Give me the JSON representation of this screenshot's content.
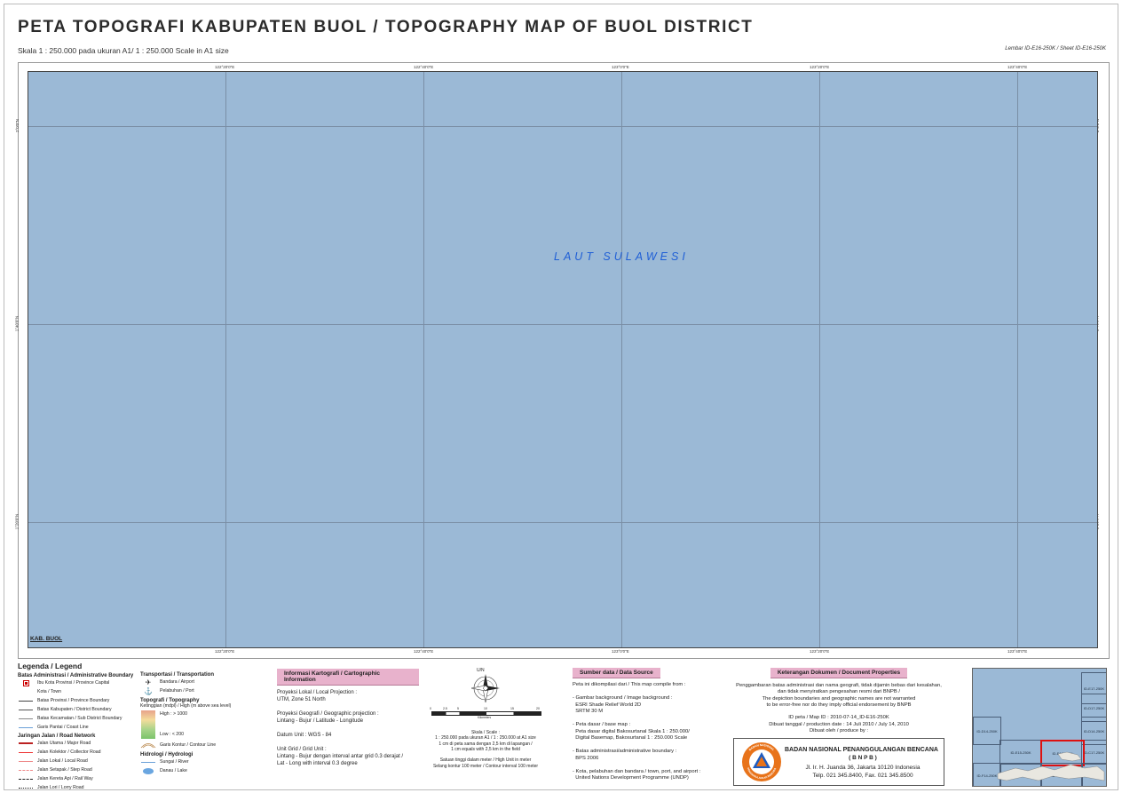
{
  "header": {
    "title": "PETA TOPOGRAFI KABUPATEN BUOL / TOPOGRAPHY MAP OF BUOL DISTRICT",
    "subtitle": "Skala 1 : 250.000 pada ukuran A1/ 1 : 250.000 Scale in A1 size",
    "sheet": "Lembar ID-E16-250K / Sheet ID-E16-250K"
  },
  "map": {
    "sea_label": "LAUT SULAWESI",
    "district_label": "KAB. BUOL",
    "sea_color": "#9bb9d6",
    "lon_ticks": [
      "122°20'0\"E",
      "122°40'0\"E",
      "123°0'0\"E",
      "123°20'0\"E",
      "123°40'0\"E"
    ],
    "lat_ticks": [
      "2°0'0\"N",
      "1°40'0\"N",
      "1°20'0\"N"
    ]
  },
  "legend": {
    "title": "Legenda / Legend",
    "admin": {
      "title": "Batas Administrasi / Administrative Boundary",
      "items": [
        "Ibu Kota Provinsi / Province Capital",
        "Kota / Town",
        "Batas Provinsi / Province Boundary",
        "Batas Kabupaten / District Boundary",
        "Batas Kecamatan / Sub District Boundary",
        "Garis Pantai / Coast Line"
      ]
    },
    "road": {
      "title": "Jaringan Jalan / Road Network",
      "items": [
        "Jalan Utama / Major Road",
        "Jalan Kolektor / Collector Road",
        "Jalan Lokal / Local Road",
        "Jalan Setapak / Step Road",
        "Jalan Kereta Api / Rail Way",
        "Jalan Lori / Lorry Road"
      ]
    },
    "transport": {
      "title": "Transportasi / Transportation",
      "items": [
        "Bandara / Airport",
        "Pelabuhan / Port"
      ]
    },
    "topo": {
      "title": "Topografi / Topography",
      "subtitle": "Ketinggian (mdpl) / High (m above sea level)",
      "high": "High : > 1000",
      "low": "Low : < 200",
      "contour": "Garis Kontur / Contour Line"
    },
    "hydro": {
      "title": "Hidrologi / Hydrologi",
      "items": [
        "Sungai / River",
        "Danau / Lake"
      ]
    }
  },
  "carto": {
    "title": "Informasi Kartografi / Cartographic Information",
    "text": "Proyeksi Lokal / Local Projection :\nUTM, Zone 51 North\n\nProyeksi Geografi / Geographic projection :\nLintang - Bujur / Latitude - Longitude\n\nDatum Unit : WGS - 84\n\nUnit Grid / Grid Unit :\nLintang - Bujur dengan interval antar grid 0.3 derajat /\nLat - Long with interval 0.3 degree"
  },
  "scale": {
    "north": "U/N",
    "bar_labels": [
      "0",
      "2.5",
      "5",
      "10",
      "15",
      "20"
    ],
    "unit": "Kilometers",
    "text": "Skala / Scale :\n1 : 250.000 pada ukuran A1 / 1 : 250.000 at A1 size\n1 cm di peta sama dengan 2,5 km di lapangan /\n1 cm equals with 2,5 km in the field\n\nSatuan tinggi dalam meter / High Unit in meter\nSelang kontur 100 meter / Contour interval 100 meter"
  },
  "source": {
    "title": "Sumber data / Data Source",
    "text": "Peta ini dikompilasi dari / This map compile from :\n\n- Gambar background / Image background :\n  ESRI Shade Relief World 2D\n  SRTM 30 M\n\n- Peta dasar / base map :\n  Peta dasar digital Bakosurtanal Skala 1 : 250.000/\n  Digital Basemap, Bakosurtanal 1 : 250.000 Scale\n\n- Batas administrasi/administrative boundary :\n  BPS 2006\n\n- Kota, pelabuhan dan bandara / town, port, and airport :\n  United Nations Development Programme (UNDP)"
  },
  "doc": {
    "title": "Keterangan Dokumen / Document Properties",
    "text": "Penggambaran batas administrasi dan nama geografi, tidak dijamin bebas dari kesalahan,\ndan tidak menyiratkan pengesahan resmi dari BNPB /\nThe depiction boundaries and geographic names are not warranted\nto be error-free nor do they imply official endorsement by BNPB\n\nID peta / Map ID : 2010-07-14_ID-E16-250K\nDibuat tanggal / production date : 14 Juli 2010 / July 14, 2010\nDibuat oleh / produce by :"
  },
  "bnpb": {
    "name": "BADAN NASIONAL PENANGGULANGAN BENCANA",
    "abbr": "( B N P B )",
    "address": "Jl. Ir. H. Juanda 36, Jakarta 10120 Indonesia",
    "phone": "Telp. 021 345.8400, Fax. 021 345.8500",
    "logo_top": "BADAN NASIONAL",
    "logo_bottom": "PENANGGULANGAN BENCANA",
    "logo_color": "#e8731a"
  },
  "inset": {
    "cells": [
      "ID-E17-250K",
      "ID-D17-250K",
      "ID-D14-250K",
      "ID-C17-250K",
      "ID-D14-250K",
      "ID-E15-250K",
      "ID-E16-250K",
      "ID-F14-250K",
      "ID-F15-250K",
      "ID-F16-250K",
      "ID-F17-250K"
    ],
    "highlight_color": "#d11"
  }
}
